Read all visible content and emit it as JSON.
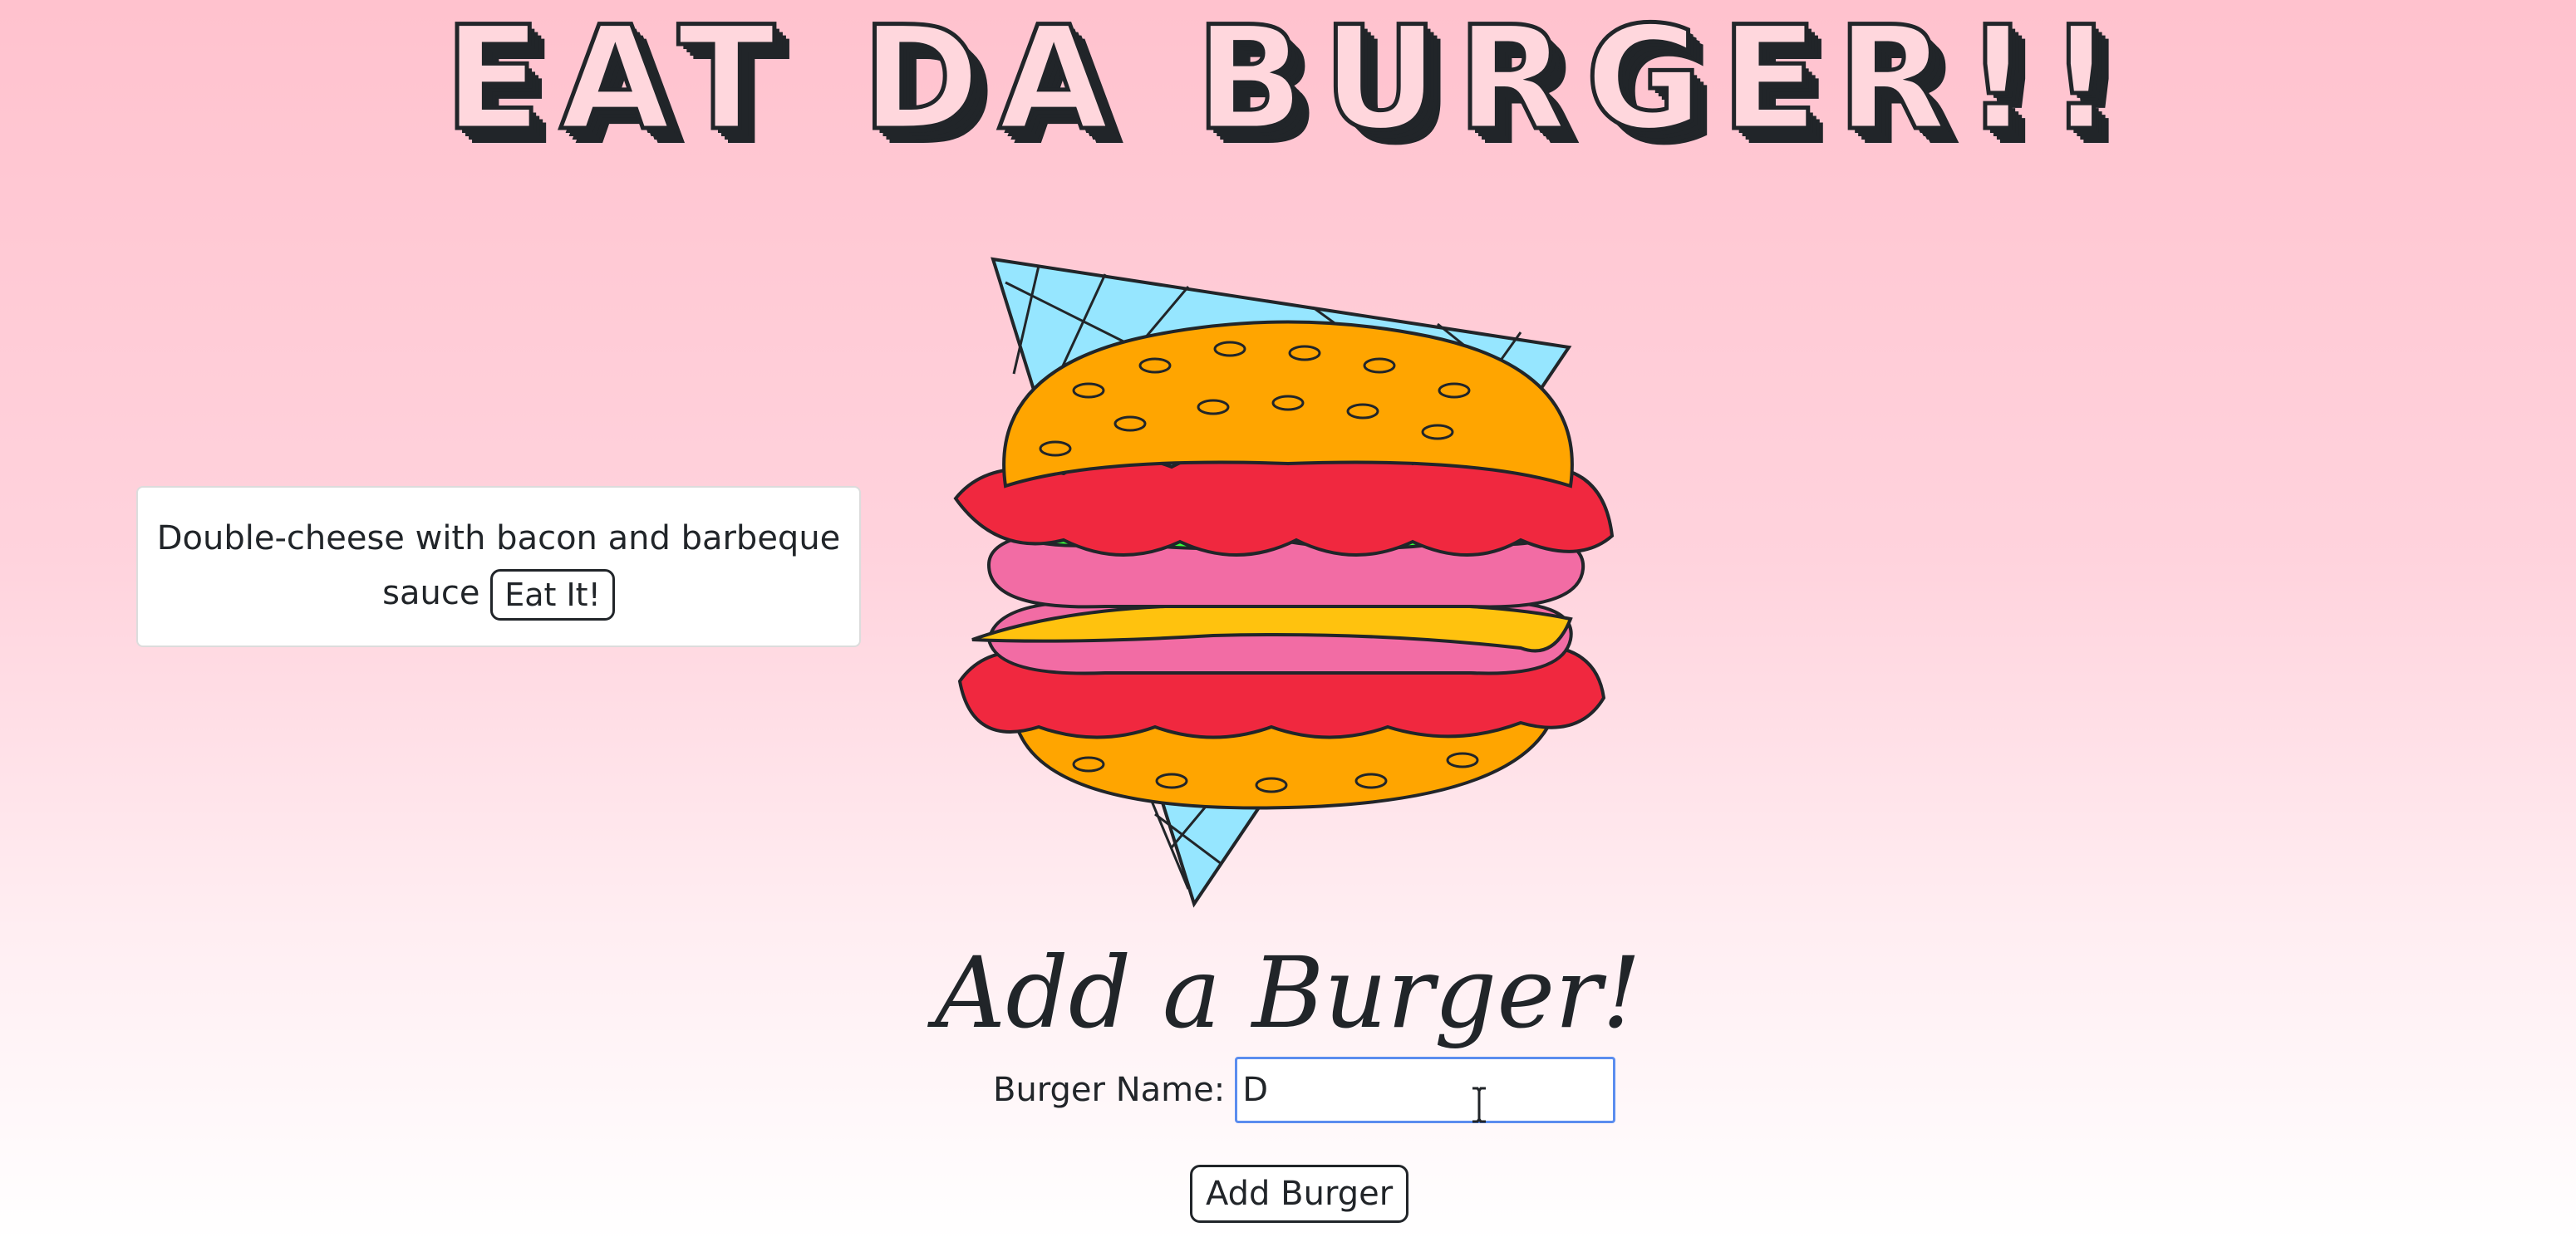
{
  "header": {
    "title": "EAT DA BURGER!!"
  },
  "burgers": [
    {
      "name_line1": "Double-cheese with bacon and barbeque",
      "name_line2": "sauce",
      "eat_label": "Eat It!"
    }
  ],
  "form": {
    "heading": "Add a Burger!",
    "label": "Burger Name:",
    "input_value": "D",
    "submit_label": "Add Burger"
  },
  "colors": {
    "background_top": "#ffc2ce",
    "background_bottom": "#ffffff",
    "input_focus_border": "#5b8def",
    "bun": "#ffa500",
    "tomato": "#f0283f",
    "lettuce": "#39ff39",
    "patty": "#f26ca4",
    "cheese": "#ffc20e",
    "triangle": "#96e6ff"
  },
  "icons": {
    "cursor": "text-cursor-icon"
  }
}
